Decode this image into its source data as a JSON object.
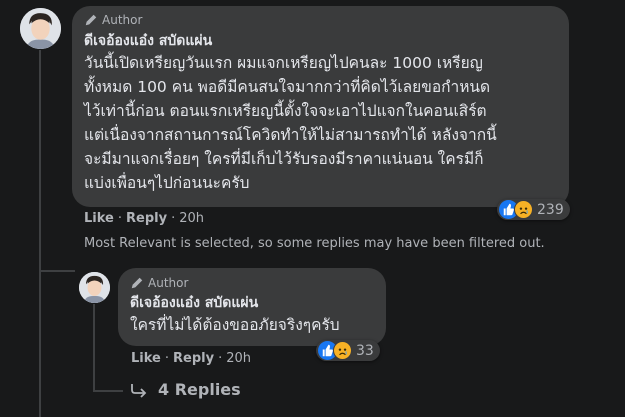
{
  "comment": {
    "author_badge": "Author",
    "author_name": "ดีเจอ้องแอ๋ง สบัดแผ่น",
    "body_lines": [
      "วันนี้เปิดเหรียญวันแรก ผมแจกเหรียญไปคนละ 1000 เหรียญ",
      "ทั้งหมด 100 คน พอดีมีคนสนใจมากกว่าที่คิดไว้เลยขอกำหนด",
      "ไว้เท่านี้ก่อน ตอนแรกเหรียญนี้ตั้งใจจะเอาไปแจกในคอนเสิร์ต",
      "แต่เนื่องจากสถานการณ์โควิดทำให้ไม่สามารถทำได้ หลังจากนี้",
      "จะมีมาแจกเรื่อยๆ ใครที่มีเก็บไว้รับรองมีราคาแน่นอน ใครมีก็",
      "แบ่งเพื่อนๆไปก่อนนะครับ"
    ],
    "like_label": "Like",
    "reply_label": "Reply",
    "separator": "·",
    "time": "20h",
    "reaction_count": "239"
  },
  "filter_note": "Most Relevant is selected, so some replies may have been filtered out.",
  "reply": {
    "author_badge": "Author",
    "author_name": "ดีเจอ้องแอ๋ง สบัดแผ่น",
    "body": "ใครที่ไม่ได้ต้องขออภัยจริงๆครับ",
    "like_label": "Like",
    "reply_label": "Reply",
    "separator": "·",
    "time": "20h",
    "reaction_count": "33"
  },
  "more_replies": {
    "icon": "reply-arrow-icon",
    "label": "4 Replies"
  },
  "colors": {
    "background": "#18191a",
    "bubble": "#3a3b3c",
    "text": "#e4e6eb",
    "muted": "#b0b3b8",
    "like_blue": "#1877f2",
    "sad_yellow": "#f7b125"
  }
}
